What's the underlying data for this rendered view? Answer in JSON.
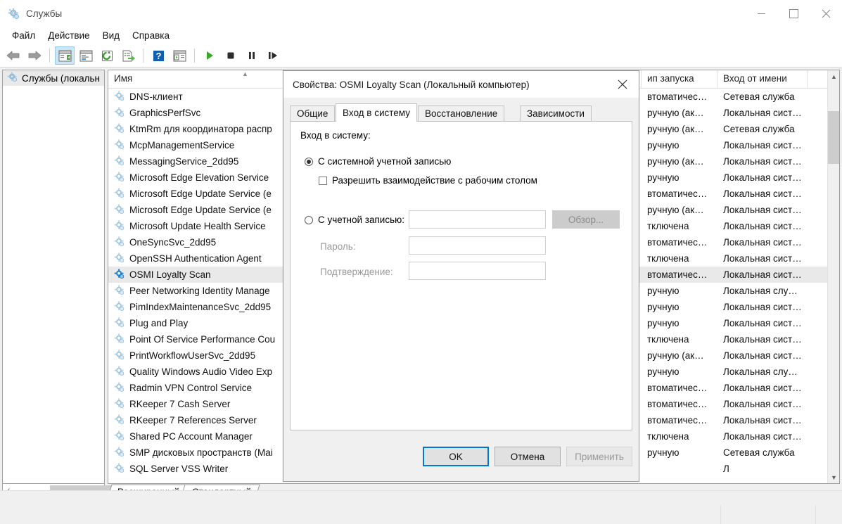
{
  "window": {
    "title": "Службы",
    "icon": "services-gear-icon",
    "controls": {
      "minimize": "minimize-icon",
      "maximize": "maximize-icon",
      "close": "close-icon"
    }
  },
  "menubar": {
    "items": [
      {
        "label": "Файл",
        "name": "menu-file"
      },
      {
        "label": "Действие",
        "name": "menu-action"
      },
      {
        "label": "Вид",
        "name": "menu-view"
      },
      {
        "label": "Справка",
        "name": "menu-help"
      }
    ]
  },
  "toolbar": {
    "buttons": [
      {
        "name": "back-arrow-icon",
        "glyph": "back"
      },
      {
        "name": "forward-arrow-icon",
        "glyph": "forward"
      },
      {
        "name": "show-hide-console-tree-icon",
        "glyph": "tree",
        "active": true
      },
      {
        "name": "properties-icon",
        "glyph": "props"
      },
      {
        "name": "refresh-icon",
        "glyph": "refresh"
      },
      {
        "name": "export-list-icon",
        "glyph": "export"
      },
      {
        "name": "help-icon",
        "glyph": "help"
      },
      {
        "name": "show-action-pane-icon",
        "glyph": "actionpane"
      },
      {
        "name": "start-service-icon",
        "glyph": "play"
      },
      {
        "name": "stop-service-icon",
        "glyph": "stop"
      },
      {
        "name": "pause-service-icon",
        "glyph": "pause"
      },
      {
        "name": "restart-service-icon",
        "glyph": "restart"
      }
    ]
  },
  "tree": {
    "root": {
      "label": "Службы (локальн",
      "icon": "services-gear-icon",
      "selected": true
    }
  },
  "list": {
    "columns": [
      {
        "key": "name",
        "label": "Имя",
        "sorted": "asc"
      },
      {
        "key": "desc",
        "label": ""
      },
      {
        "key": "state",
        "label": ""
      },
      {
        "key": "start",
        "label": "ип запуска"
      },
      {
        "key": "logon",
        "label": "Вход от имени"
      }
    ],
    "rows": [
      {
        "name": "DNS-клиент",
        "desc": "",
        "state": "",
        "start": "втоматичес…",
        "logon": "Сетевая служба",
        "selected": false
      },
      {
        "name": "GraphicsPerfSvc",
        "desc": "",
        "state": "",
        "start": "ручную (ак…",
        "logon": "Локальная сист…",
        "selected": false
      },
      {
        "name": "KtmRm для координатора распр",
        "desc": "",
        "state": "",
        "start": "ручную (ак…",
        "logon": "Сетевая служба",
        "selected": false
      },
      {
        "name": "McpManagementService",
        "desc": "",
        "state": "",
        "start": "ручную",
        "logon": "Локальная сист…",
        "selected": false
      },
      {
        "name": "MessagingService_2dd95",
        "desc": "",
        "state": "",
        "start": "ручную (ак…",
        "logon": "Локальная сист…",
        "selected": false
      },
      {
        "name": "Microsoft Edge Elevation Service",
        "desc": "",
        "state": "",
        "start": "ручную",
        "logon": "Локальная сист…",
        "selected": false
      },
      {
        "name": "Microsoft Edge Update Service (e",
        "desc": "",
        "state": "",
        "start": "втоматичес…",
        "logon": "Локальная сист…",
        "selected": false
      },
      {
        "name": "Microsoft Edge Update Service (e",
        "desc": "",
        "state": "",
        "start": "ручную (ак…",
        "logon": "Локальная сист…",
        "selected": false
      },
      {
        "name": "Microsoft Update Health Service",
        "desc": "",
        "state": "",
        "start": "тключена",
        "logon": "Локальная сист…",
        "selected": false
      },
      {
        "name": "OneSyncSvc_2dd95",
        "desc": "",
        "state": "",
        "start": "втоматичес…",
        "logon": "Локальная сист…",
        "selected": false
      },
      {
        "name": "OpenSSH Authentication Agent",
        "desc": "",
        "state": "",
        "start": "тключена",
        "logon": "Локальная сист…",
        "selected": false
      },
      {
        "name": "OSMI Loyalty Scan",
        "desc": "",
        "state": "",
        "start": "втоматичес…",
        "logon": "Локальная сист…",
        "selected": true
      },
      {
        "name": "Peer Networking Identity Manage",
        "desc": "",
        "state": "",
        "start": "ручную",
        "logon": "Локальная слу…",
        "selected": false
      },
      {
        "name": "PimIndexMaintenanceSvc_2dd95",
        "desc": "",
        "state": "",
        "start": "ручную",
        "logon": "Локальная сист…",
        "selected": false
      },
      {
        "name": "Plug and Play",
        "desc": "",
        "state": "",
        "start": "ручную",
        "logon": "Локальная сист…",
        "selected": false
      },
      {
        "name": "Point Of Service Performance Cou",
        "desc": "",
        "state": "",
        "start": "тключена",
        "logon": "Локальная сист…",
        "selected": false
      },
      {
        "name": "PrintWorkflowUserSvc_2dd95",
        "desc": "",
        "state": "",
        "start": "ручную (ак…",
        "logon": "Локальная сист…",
        "selected": false
      },
      {
        "name": "Quality Windows Audio Video Exp",
        "desc": "",
        "state": "",
        "start": "ручную",
        "logon": "Локальная слу…",
        "selected": false
      },
      {
        "name": "Radmin VPN Control Service",
        "desc": "",
        "state": "",
        "start": "втоматичес…",
        "logon": "Локальная сист…",
        "selected": false
      },
      {
        "name": "RKeeper 7 Cash Server",
        "desc": "",
        "state": "",
        "start": "втоматичес…",
        "logon": "Локальная сист…",
        "selected": false
      },
      {
        "name": "RKeeper 7 References Server",
        "desc": "",
        "state": "",
        "start": "втоматичес…",
        "logon": "Локальная сист…",
        "selected": false
      },
      {
        "name": "Shared PC Account Manager",
        "desc": "",
        "state": "",
        "start": "тключена",
        "logon": "Локальная сист…",
        "selected": false
      },
      {
        "name": "SMP дисковых пространств (Mai",
        "desc": "",
        "state": "",
        "start": "ручную",
        "logon": "Сетевая служба",
        "selected": false
      },
      {
        "name": "SQL Server VSS Writer",
        "desc": "",
        "state": "",
        "start": "",
        "logon": "Л",
        "selected": false
      }
    ]
  },
  "bottom_tabs": [
    {
      "label": "Расширенный",
      "name": "tab-extended",
      "selected": false
    },
    {
      "label": "Стандартный",
      "name": "tab-standard",
      "selected": true
    }
  ],
  "hscroll": {
    "left_arrow": "‹",
    "right_arrow": "›"
  },
  "dialog": {
    "title": "Свойства: OSMI Loyalty Scan (Локальный компьютер)",
    "close_label": "close-icon",
    "tabs": [
      {
        "label": "Общие",
        "name": "tab-general",
        "selected": false
      },
      {
        "label": "Вход в систему",
        "name": "tab-logon",
        "selected": true
      },
      {
        "label": "Восстановление",
        "name": "tab-recovery",
        "selected": false
      },
      {
        "label": "Зависимости",
        "name": "tab-dependencies",
        "selected": false
      }
    ],
    "page": {
      "section_label": "Вход в систему:",
      "radio_system": {
        "label": "С системной учетной записью",
        "checked": true
      },
      "checkbox_desktop": {
        "label": "Разрешить взаимодействие с рабочим столом",
        "checked": false
      },
      "radio_account": {
        "label": "С учетной записью:",
        "checked": false
      },
      "account_value": "",
      "browse_button": "Обзор...",
      "password_label": "Пароль:",
      "password_value": "",
      "confirm_label": "Подтверждение:",
      "confirm_value": ""
    },
    "buttons": {
      "ok": "OK",
      "cancel": "Отмена",
      "apply": "Применить",
      "apply_disabled": true
    }
  },
  "colors": {
    "accent": "#0078d7",
    "selection": "#e9e9e9",
    "toolbar_active": "#cce5f7",
    "service_icon": "#7aafd4",
    "service_icon_selected": "#1b7fd0",
    "play_green": "#3aa828",
    "stop_black": "#2b2b2b"
  }
}
